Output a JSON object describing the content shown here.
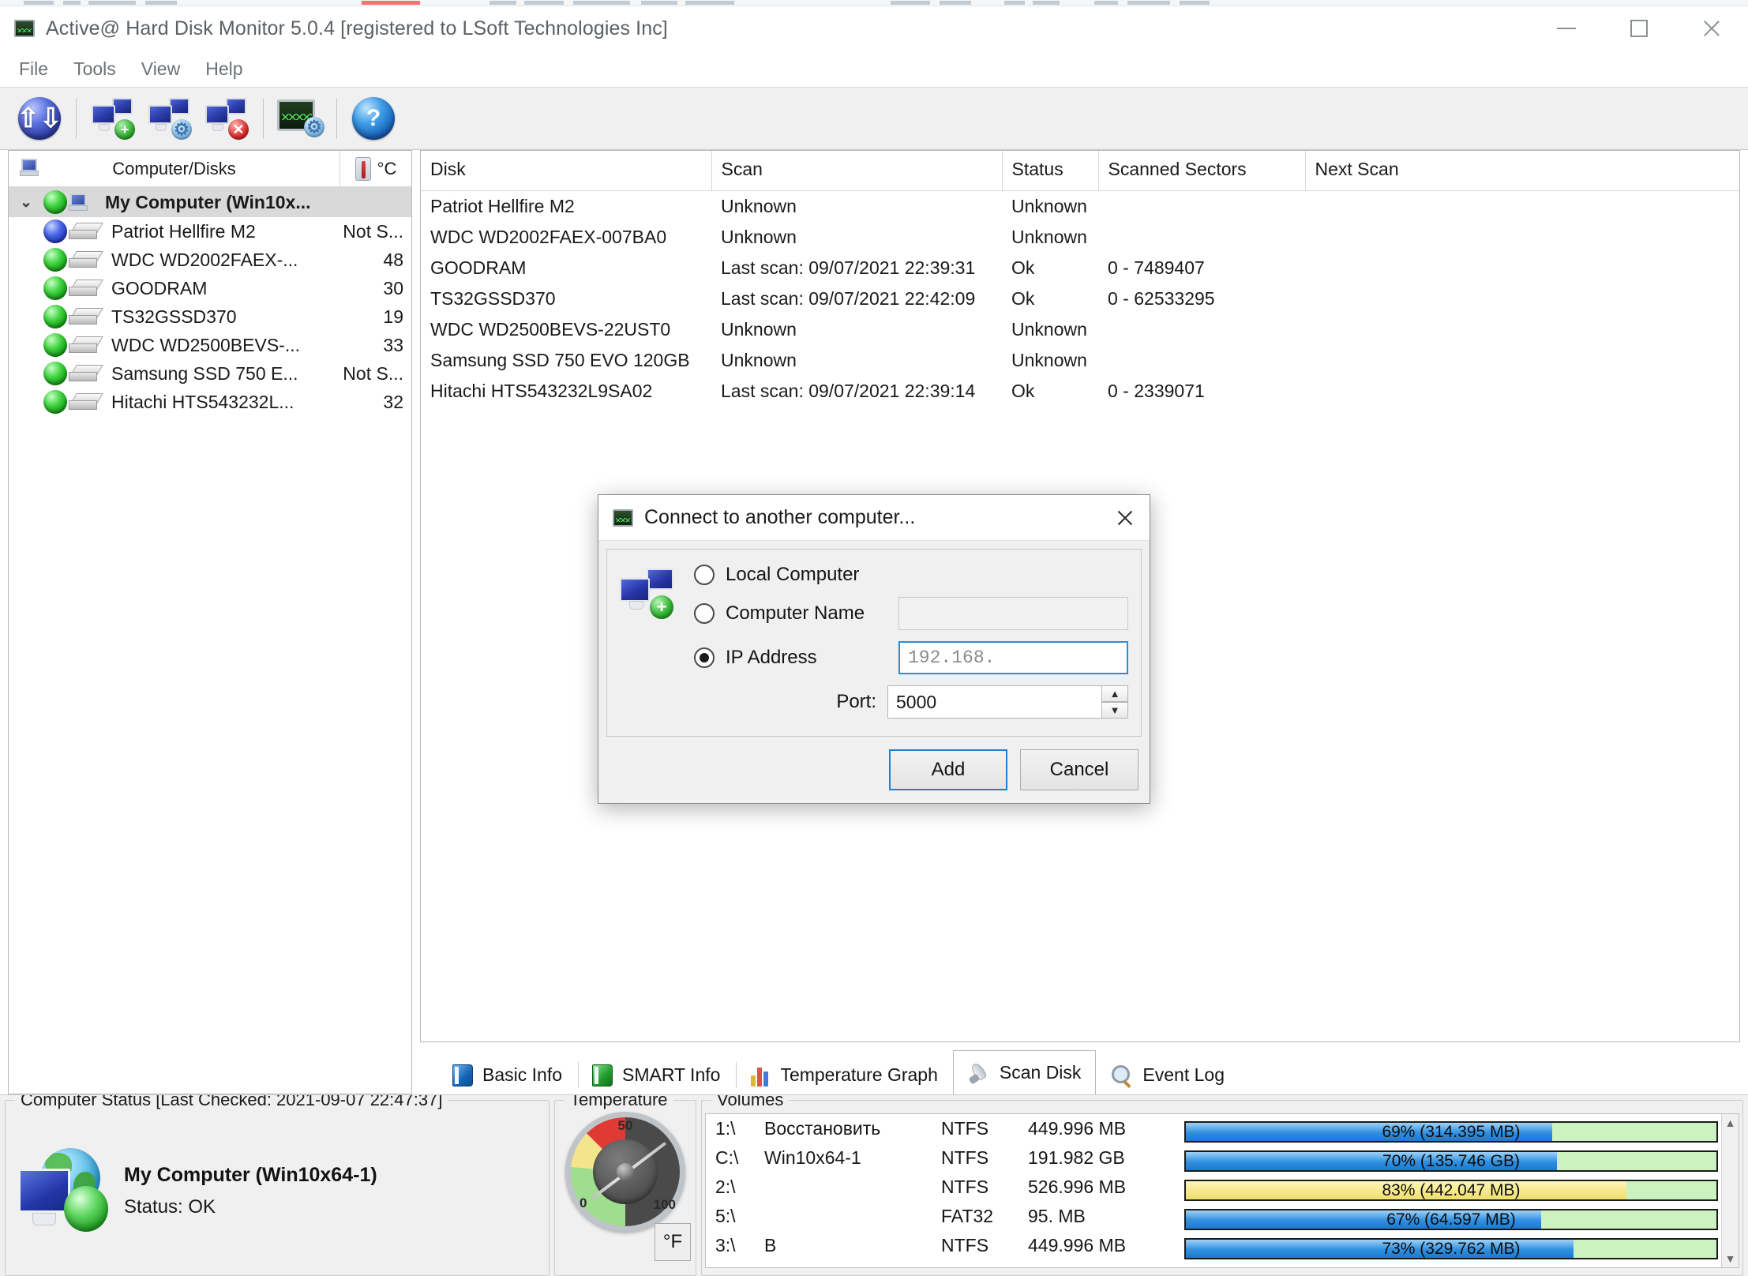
{
  "window": {
    "title": "Active@ Hard Disk Monitor 5.0.4 [registered to LSoft Technologies Inc]",
    "title_icon": "oscilloscope-icon",
    "minimize": "—",
    "maximize": "□",
    "close": "✕"
  },
  "menu": {
    "items": [
      "File",
      "Tools",
      "View",
      "Help"
    ]
  },
  "toolbar": {
    "buttons": [
      {
        "name": "refresh-button",
        "icon": "refresh-arrows-icon",
        "glyph": "↺"
      },
      {
        "name": "connect-computer-button",
        "icon": "monitor-plus-icon",
        "glyph": "+"
      },
      {
        "name": "computer-settings-button",
        "icon": "monitor-gear-icon",
        "glyph": "⚙"
      },
      {
        "name": "disconnect-computer-button",
        "icon": "monitor-remove-icon",
        "glyph": "✕"
      },
      {
        "name": "monitor-settings-button",
        "icon": "scope-gear-icon",
        "glyph": "⚙"
      },
      {
        "name": "help-button",
        "icon": "question-mark-icon",
        "glyph": "?"
      }
    ]
  },
  "tree": {
    "header": {
      "col_disks": "Computer/Disks",
      "col_temp": "°C",
      "pc_icon": "computer-icon",
      "temp_icon": "thermometer-icon"
    },
    "root": {
      "label": "My Computer (Win10x...",
      "chevron": "⌄",
      "orb": "green"
    },
    "disks": [
      {
        "label": "Patriot Hellfire M2",
        "temp": "Not S...",
        "orb": "blue"
      },
      {
        "label": "WDC WD2002FAEX-...",
        "temp": "48",
        "orb": "green"
      },
      {
        "label": "GOODRAM",
        "temp": "30",
        "orb": "green"
      },
      {
        "label": "TS32GSSD370",
        "temp": "19",
        "orb": "green"
      },
      {
        "label": "WDC WD2500BEVS-...",
        "temp": "33",
        "orb": "green"
      },
      {
        "label": "Samsung SSD 750 E...",
        "temp": "Not S...",
        "orb": "green"
      },
      {
        "label": "Hitachi HTS543232L...",
        "temp": "32",
        "orb": "green"
      }
    ]
  },
  "grid": {
    "columns": [
      "Disk",
      "Scan",
      "Status",
      "Scanned Sectors",
      "Next Scan"
    ],
    "rows": [
      {
        "disk": "Patriot Hellfire M2",
        "scan": "Unknown",
        "status": "Unknown",
        "sectors": "",
        "next": ""
      },
      {
        "disk": "WDC WD2002FAEX-007BA0",
        "scan": "Unknown",
        "status": "Unknown",
        "sectors": "",
        "next": ""
      },
      {
        "disk": "GOODRAM",
        "scan": "Last scan: 09/07/2021 22:39:31",
        "status": "Ok",
        "sectors": "0 - 7489407",
        "next": ""
      },
      {
        "disk": "TS32GSSD370",
        "scan": "Last scan: 09/07/2021 22:42:09",
        "status": "Ok",
        "sectors": "0 - 62533295",
        "next": ""
      },
      {
        "disk": "WDC WD2500BEVS-22UST0",
        "scan": "Unknown",
        "status": "Unknown",
        "sectors": "",
        "next": ""
      },
      {
        "disk": "Samsung SSD 750 EVO 120GB",
        "scan": "Unknown",
        "status": "Unknown",
        "sectors": "",
        "next": ""
      },
      {
        "disk": "Hitachi HTS543232L9SA02",
        "scan": "Last scan: 09/07/2021 22:39:14",
        "status": "Ok",
        "sectors": "0 - 2339071",
        "next": ""
      }
    ]
  },
  "tabs": {
    "items": [
      {
        "label": "Basic Info",
        "icon": "blue-book-icon",
        "active": false
      },
      {
        "label": "SMART Info",
        "icon": "green-book-icon",
        "active": false
      },
      {
        "label": "Temperature Graph",
        "icon": "bar-chart-icon",
        "active": false
      },
      {
        "label": "Scan Disk",
        "icon": "rocket-icon",
        "active": true
      },
      {
        "label": "Event Log",
        "icon": "magnifier-icon",
        "active": false
      }
    ]
  },
  "status": {
    "computer": {
      "legend": "Computer Status [Last Checked: 2021-09-07 22:47:37]",
      "icon": "globe-monitor-icon",
      "name": "My Computer (Win10x64-1)",
      "status_line": "Status: OK"
    },
    "temperature": {
      "legend": "Temperature",
      "unit_button": "°F",
      "gauge_labels": {
        "min": "0",
        "mid": "50",
        "max": "100"
      }
    },
    "volumes": {
      "legend": "Volumes",
      "rows": [
        {
          "drive": "1:\\",
          "label": "Восстановить",
          "fs": "NTFS",
          "size": "449.996 MB",
          "usage_text": "69% (314.395 MB)",
          "percent": 69,
          "color": "blue"
        },
        {
          "drive": "C:\\",
          "label": "Win10x64-1",
          "fs": "NTFS",
          "size": "191.982 GB",
          "usage_text": "70% (135.746 GB)",
          "percent": 70,
          "color": "blue"
        },
        {
          "drive": "2:\\",
          "label": "",
          "fs": "NTFS",
          "size": "526.996 MB",
          "usage_text": "83% (442.047 MB)",
          "percent": 83,
          "color": "yellow"
        },
        {
          "drive": "5:\\",
          "label": "",
          "fs": "FAT32",
          "size": "95. MB",
          "usage_text": "67% (64.597 MB)",
          "percent": 67,
          "color": "blue"
        },
        {
          "drive": "3:\\",
          "label": "B",
          "fs": "NTFS",
          "size": "449.996 MB",
          "usage_text": "73% (329.762 MB)",
          "percent": 73,
          "color": "blue"
        }
      ]
    }
  },
  "dialog": {
    "title": "Connect to another computer...",
    "title_icon": "oscilloscope-icon",
    "side_icon": "monitor-plus-icon",
    "close_icon": "close-icon",
    "options": {
      "local": {
        "label": "Local Computer",
        "selected": false
      },
      "computer_name": {
        "label": "Computer Name",
        "selected": false,
        "value": "",
        "placeholder": ""
      },
      "ip_address": {
        "label": "IP Address",
        "selected": true,
        "value": "192.168."
      }
    },
    "port": {
      "label": "Port:",
      "value": "5000",
      "up": "▲",
      "down": "▼"
    },
    "buttons": {
      "add": "Add",
      "cancel": "Cancel"
    }
  }
}
